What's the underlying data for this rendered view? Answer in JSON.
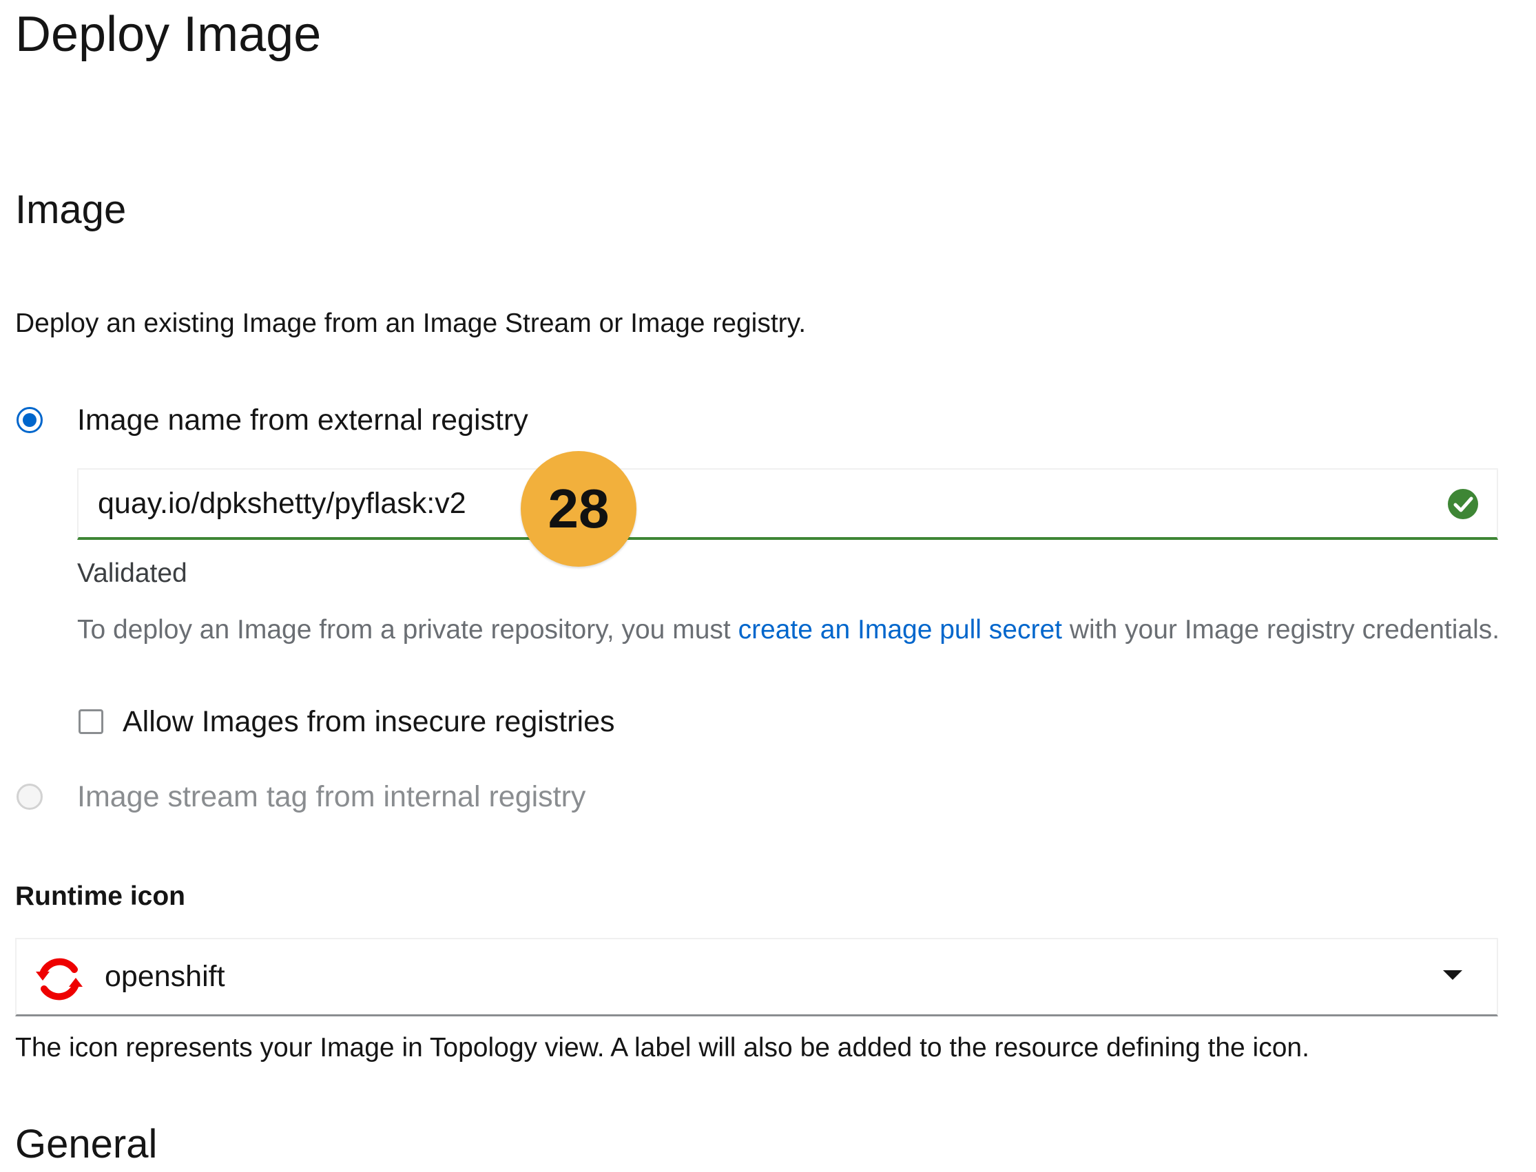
{
  "page": {
    "title": "Deploy Image"
  },
  "image_section": {
    "title": "Image",
    "description": "Deploy an existing Image from an Image Stream or Image registry.",
    "option_external": {
      "label": "Image name from external registry",
      "selected": true,
      "input_value": "quay.io/dpkshetty/pyflask:v2",
      "validation_text": "Validated",
      "helper_before": "To deploy an Image from a private repository, you must ",
      "helper_link": "create an Image pull secret",
      "helper_after": " with your Image registry credentials.",
      "insecure_checkbox_label": "Allow Images from insecure registries",
      "insecure_checked": false
    },
    "option_internal": {
      "label": "Image stream tag from internal registry",
      "selected": false,
      "disabled": true
    }
  },
  "runtime_icon": {
    "label": "Runtime icon",
    "selected_value": "openshift",
    "selected_icon": "openshift-icon",
    "helper": "The icon represents your Image in Topology view. A label will also be added to the resource defining the icon."
  },
  "general_section": {
    "title": "General"
  },
  "annotation": {
    "badge_number": "28",
    "color": "#f2b03c"
  },
  "colors": {
    "primary": "#0066cc",
    "success": "#3e8635",
    "openshift_red": "#ee0000",
    "muted_text": "#6a6e73"
  }
}
